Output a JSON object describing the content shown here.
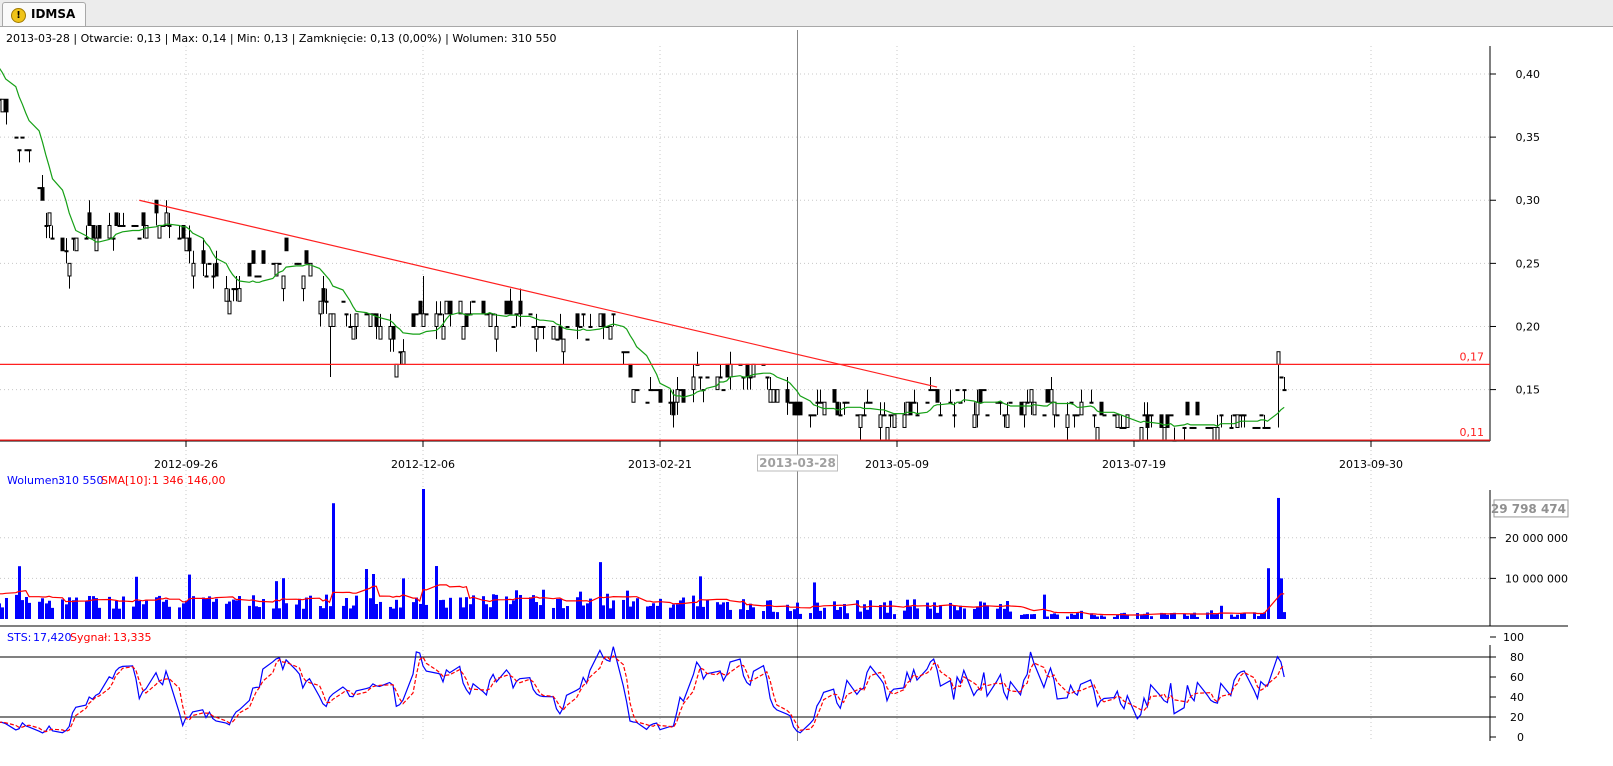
{
  "tab": {
    "label": "IDMSA",
    "icon": "warning-icon"
  },
  "colors": {
    "candle": "#000000",
    "sma_line": "#16a016",
    "trendline": "#ff2020",
    "volume": "#0000ff",
    "volume_sma": "#ff0000",
    "sts": "#0000ff",
    "signal": "#ff0000",
    "grid": "#c8c8c8"
  },
  "chart_data": [
    {
      "type": "candlestick",
      "info": {
        "date": "2013-03-28",
        "open_label": "Otwarcie",
        "open": "0,13",
        "max_label": "Max",
        "max": "0,14",
        "min_label": "Min",
        "min": "0,13",
        "close_label": "Zamknięcie",
        "close": "0,13",
        "change": "(0,00%)",
        "volume_label": "Wolumen",
        "volume": "310 550"
      },
      "x_tick_labels": [
        "2012-09-26",
        "2012-12-06",
        "2013-02-21",
        "2013-05-09",
        "2013-07-19",
        "2013-09-30"
      ],
      "x_cursor_label": "2013-03-28",
      "y_tick_labels": [
        "0,40",
        "0,35",
        "0,30",
        "0,25",
        "0,20",
        "0,15"
      ],
      "ylim": [
        0.108,
        0.44
      ],
      "grid": true,
      "horizontal_levels": [
        {
          "value": 0.17,
          "label": "0,17"
        },
        {
          "value": 0.11,
          "label": "0,11"
        }
      ],
      "trendline": {
        "from": {
          "x": "2012-09-12",
          "y": 0.3
        },
        "to": {
          "x": "2013-05-09",
          "y": 0.152
        }
      },
      "anchors": [
        {
          "d": "2012-07-23",
          "c": 0.41
        },
        {
          "d": "2012-08-01",
          "c": 0.38
        },
        {
          "d": "2012-08-10",
          "c": 0.33
        },
        {
          "d": "2012-08-20",
          "c": 0.25
        },
        {
          "d": "2012-08-28",
          "c": 0.28
        },
        {
          "d": "2012-09-10",
          "c": 0.27
        },
        {
          "d": "2012-09-20",
          "c": 0.285
        },
        {
          "d": "2012-09-28",
          "c": 0.255
        },
        {
          "d": "2012-10-10",
          "c": 0.225
        },
        {
          "d": "2012-10-22",
          "c": 0.25
        },
        {
          "d": "2012-11-01",
          "c": 0.245
        },
        {
          "d": "2012-11-08",
          "c": 0.21
        },
        {
          "d": "2012-11-20",
          "c": 0.205
        },
        {
          "d": "2012-11-28",
          "c": 0.18
        },
        {
          "d": "2012-12-03",
          "c": 0.205
        },
        {
          "d": "2012-12-12",
          "c": 0.21
        },
        {
          "d": "2013-01-02",
          "c": 0.205
        },
        {
          "d": "2013-01-23",
          "c": 0.2
        },
        {
          "d": "2013-02-01",
          "c": 0.2
        },
        {
          "d": "2013-02-06",
          "c": 0.16
        },
        {
          "d": "2013-02-18",
          "c": 0.14
        },
        {
          "d": "2013-02-28",
          "c": 0.16
        },
        {
          "d": "2013-03-18",
          "c": 0.165
        },
        {
          "d": "2013-03-28",
          "c": 0.13
        },
        {
          "d": "2013-04-15",
          "c": 0.14
        },
        {
          "d": "2013-04-25",
          "c": 0.13
        },
        {
          "d": "2013-05-09",
          "c": 0.14
        },
        {
          "d": "2013-06-05",
          "c": 0.14
        },
        {
          "d": "2013-06-20",
          "c": 0.135
        },
        {
          "d": "2013-07-05",
          "c": 0.125
        },
        {
          "d": "2013-07-25",
          "c": 0.123
        },
        {
          "d": "2013-08-16",
          "c": 0.125
        },
        {
          "d": "2013-08-19",
          "c": 0.17
        },
        {
          "d": "2013-08-21",
          "c": 0.15
        }
      ]
    },
    {
      "type": "bar",
      "legend": {
        "volume_label": "Wolumen:",
        "volume": "310 550",
        "sma_label": "SMA[10]:",
        "sma": "1 346 146,00"
      },
      "y_tick_labels": [
        "20 000 000",
        "10 000 000"
      ],
      "last_value_label": "29 798 474",
      "ylim": [
        0,
        32000000
      ],
      "max_value": 29798474
    },
    {
      "type": "line",
      "legend": {
        "sts_label": "STS:",
        "sts": "17,420",
        "signal_label": "Sygnał:",
        "signal": "13,335"
      },
      "y_tick_labels": [
        "100",
        "80",
        "60",
        "40",
        "20",
        "0"
      ],
      "ylim": [
        0,
        100
      ],
      "levels": [
        80,
        20
      ]
    }
  ]
}
